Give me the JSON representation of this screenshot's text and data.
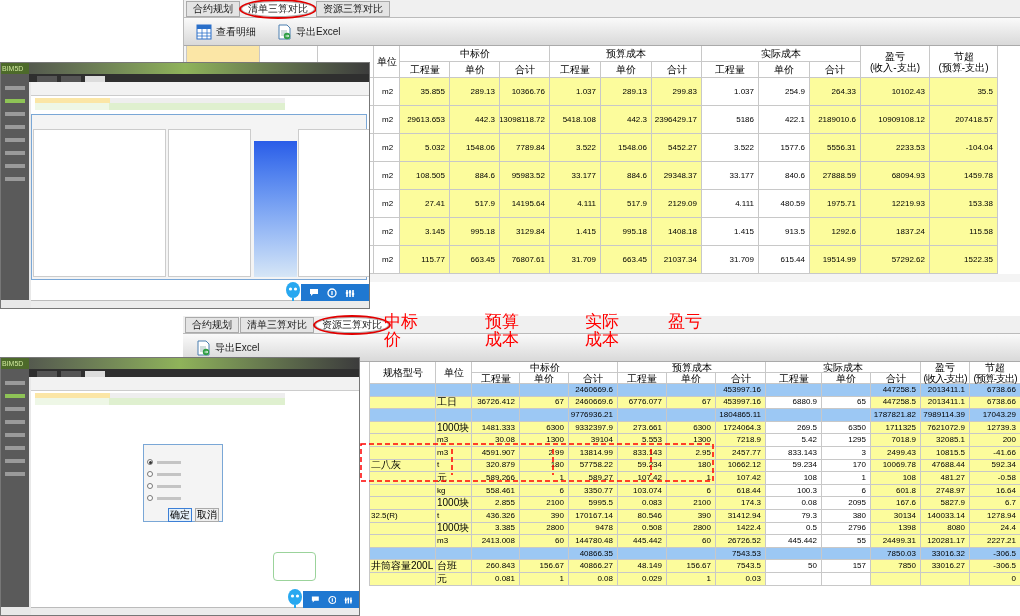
{
  "top_panel": {
    "tabs": [
      {
        "label": "合约规划",
        "selected": false
      },
      {
        "label": "清单三算对比",
        "selected": true
      },
      {
        "label": "资源三算对比",
        "selected": false
      }
    ],
    "toolbar": [
      {
        "kind": "details",
        "label": "查看明细"
      },
      {
        "kind": "export",
        "label": "导出Excel"
      }
    ],
    "table": {
      "left_columns": [
        "单位"
      ],
      "groups": [
        {
          "label": "中标价",
          "columns": [
            "工程量",
            "单价",
            "合计"
          ]
        },
        {
          "label": "预算成本",
          "columns": [
            "工程量",
            "单价",
            "合计"
          ]
        },
        {
          "label": "实际成本",
          "columns": [
            "工程量",
            "单价",
            "合计"
          ]
        }
      ],
      "right_columns": [
        {
          "title": "盈亏",
          "subtitle": "(收入-支出)"
        },
        {
          "title": "节超",
          "subtitle": "(预算-支出)"
        }
      ],
      "rows": [
        {
          "cells": [
            "m2",
            "35.855",
            "289.13",
            "10366.76",
            "1.037",
            "289.13",
            "299.83",
            "1.037",
            "254.9",
            "264.33",
            "10102.43",
            "35.5"
          ]
        },
        {
          "cells": [
            "m2",
            "29613.653",
            "442.3",
            "13098118.72",
            "5418.108",
            "442.3",
            "2396429.17",
            "5186",
            "422.1",
            "2189010.6",
            "10909108.12",
            "207418.57"
          ]
        },
        {
          "cells": [
            "m2",
            "5.032",
            "1548.06",
            "7789.84",
            "3.522",
            "1548.06",
            "5452.27",
            "3.522",
            "1577.6",
            "5556.31",
            "2233.53",
            "-104.04"
          ]
        },
        {
          "cells": [
            "m2",
            "108.505",
            "884.6",
            "95983.52",
            "33.177",
            "884.6",
            "29348.37",
            "33.177",
            "840.6",
            "27888.59",
            "68094.93",
            "1459.78"
          ]
        },
        {
          "cells": [
            "m2",
            "27.41",
            "517.9",
            "14195.64",
            "4.111",
            "517.9",
            "2129.09",
            "4.111",
            "480.59",
            "1975.71",
            "12219.93",
            "153.38"
          ]
        },
        {
          "cells": [
            "m2",
            "3.145",
            "995.18",
            "3129.84",
            "1.415",
            "995.18",
            "1408.18",
            "1.415",
            "913.5",
            "1292.6",
            "1837.24",
            "115.58"
          ]
        },
        {
          "cells": [
            "m2",
            "115.77",
            "663.45",
            "76807.61",
            "31.709",
            "663.45",
            "21037.34",
            "31.709",
            "615.44",
            "19514.99",
            "57292.62",
            "1522.35"
          ]
        }
      ]
    }
  },
  "bottom_panel": {
    "tabs": [
      {
        "label": "合约规划",
        "selected": false
      },
      {
        "label": "清单三算对比",
        "selected": false
      },
      {
        "label": "资源三算对比",
        "selected": true
      }
    ],
    "toolbar": [
      {
        "kind": "export",
        "label": "导出Excel"
      }
    ],
    "table": {
      "left_columns": [
        "规格型号",
        "单位"
      ],
      "groups": [
        {
          "label": "中标价",
          "columns": [
            "工程量",
            "单价",
            "合计"
          ]
        },
        {
          "label": "预算成本",
          "columns": [
            "工程量",
            "单价",
            "合计"
          ]
        },
        {
          "label": "实际成本",
          "columns": [
            "工程量",
            "单价",
            "合计"
          ]
        }
      ],
      "right_columns": [
        {
          "title": "盈亏",
          "subtitle": "(收入-支出)"
        },
        {
          "title": "节超",
          "subtitle": "(预算-支出)"
        }
      ],
      "rows": [
        {
          "kind": "subtotal",
          "cells": [
            null,
            null,
            null,
            null,
            "2460669.6",
            null,
            null,
            "453997.16",
            null,
            null,
            "447258.5",
            "2013411.1",
            "6738.66"
          ]
        },
        {
          "kind": "item",
          "cells": [
            null,
            "工日",
            "36726.412",
            "67",
            "2460669.6",
            "6776.077",
            "67",
            "453997.16",
            "6880.9",
            "65",
            "447258.5",
            "2013411.1",
            "6738.66"
          ]
        },
        {
          "kind": "subtotal",
          "cells": [
            null,
            null,
            null,
            null,
            "9776936.21",
            null,
            null,
            "1804865.11",
            null,
            null,
            "1787821.82",
            "7989114.39",
            "17043.29"
          ]
        },
        {
          "kind": "item",
          "cells": [
            null,
            "1000块",
            "1481.333",
            "6300",
            "9332397.9",
            "273.661",
            "6300",
            "1724064.3",
            "269.5",
            "6350",
            "1711325",
            "7621072.9",
            "12739.3"
          ]
        },
        {
          "kind": "item",
          "cells": [
            null,
            "m3",
            "30.08",
            "1300",
            "39104",
            "5.553",
            "1300",
            "7218.9",
            "5.42",
            "1295",
            "7018.9",
            "32085.1",
            "200"
          ]
        },
        {
          "kind": "item",
          "cells": [
            null,
            "m3",
            "4591.907",
            "2.99",
            "13814.99",
            "833.143",
            "2.95",
            "2457.77",
            "833.143",
            "3",
            "2499.43",
            "10815.5",
            "-41.66"
          ]
        },
        {
          "kind": "item",
          "cells": [
            "二八灰",
            "t",
            "320.879",
            "180",
            "57758.22",
            "59.234",
            "180",
            "10662.12",
            "59.234",
            "170",
            "10069.78",
            "47688.44",
            "592.34"
          ]
        },
        {
          "kind": "item",
          "cells": [
            null,
            "元",
            "589.266",
            "1",
            "589.27",
            "107.42",
            "1",
            "107.42",
            "108",
            "1",
            "108",
            "481.27",
            "-0.58"
          ]
        },
        {
          "kind": "item",
          "cells": [
            null,
            "kg",
            "558.461",
            "6",
            "3350.77",
            "103.074",
            "6",
            "618.44",
            "100.3",
            "6",
            "601.8",
            "2748.97",
            "16.64"
          ]
        },
        {
          "kind": "item",
          "cells": [
            null,
            "1000块",
            "2.855",
            "2100",
            "5995.5",
            "0.083",
            "2100",
            "174.3",
            "0.08",
            "2095",
            "167.6",
            "5827.9",
            "6.7"
          ]
        },
        {
          "kind": "item",
          "cells": [
            "32.5(R)",
            "t",
            "436.326",
            "390",
            "170167.14",
            "80.546",
            "390",
            "31412.94",
            "79.3",
            "380",
            "30134",
            "140033.14",
            "1278.94"
          ]
        },
        {
          "kind": "item",
          "cells": [
            null,
            "1000块",
            "3.385",
            "2800",
            "9478",
            "0.508",
            "2800",
            "1422.4",
            "0.5",
            "2796",
            "1398",
            "8080",
            "24.4"
          ]
        },
        {
          "kind": "item",
          "cells": [
            null,
            "m3",
            "2413.008",
            "60",
            "144780.48",
            "445.442",
            "60",
            "26726.52",
            "445.442",
            "55",
            "24499.31",
            "120281.17",
            "2227.21"
          ]
        },
        {
          "kind": "subtotal",
          "cells": [
            null,
            null,
            null,
            null,
            "40866.35",
            null,
            null,
            "7543.53",
            null,
            null,
            "7850.03",
            "33016.32",
            "-306.5"
          ]
        },
        {
          "kind": "item",
          "cells": [
            "井筒容量200L",
            "台班",
            "260.843",
            "156.67",
            "40866.27",
            "48.149",
            "156.67",
            "7543.5",
            "50",
            "157",
            "7850",
            "33016.27",
            "-306.5"
          ]
        },
        {
          "kind": "item",
          "cells": [
            null,
            "元",
            "0.081",
            "1",
            "0.08",
            "0.029",
            "1",
            "0.03",
            null,
            null,
            null,
            null,
            "0"
          ]
        }
      ]
    },
    "annotations": [
      "中标价",
      "预算成本",
      "实际成本",
      "盈亏"
    ]
  },
  "app_windows": [
    {
      "kind": "model",
      "logo": "BIM5D",
      "tabs": [
        {
          "selected": false
        },
        {
          "selected": false
        },
        {
          "selected": true
        }
      ],
      "sidebar": [
        {
          "selected": false
        },
        {
          "selected": true
        },
        {
          "selected": false
        },
        {
          "selected": false
        },
        {
          "selected": false
        },
        {
          "selected": false
        },
        {
          "selected": false
        },
        {
          "selected": false
        }
      ]
    },
    {
      "kind": "import",
      "logo": "BIM5D",
      "tabs": [
        {
          "selected": false
        },
        {
          "selected": false
        },
        {
          "selected": true
        }
      ],
      "sidebar": [
        {
          "selected": false
        },
        {
          "selected": true
        },
        {
          "selected": false
        },
        {
          "selected": false
        },
        {
          "selected": false
        },
        {
          "selected": false
        },
        {
          "selected": false
        },
        {
          "selected": false
        }
      ],
      "dialog": {
        "options": [
          {
            "selected": true
          },
          {
            "selected": false
          },
          {
            "selected": false
          },
          {
            "selected": false
          }
        ],
        "buttons": [
          "确定",
          "取消"
        ]
      }
    }
  ]
}
